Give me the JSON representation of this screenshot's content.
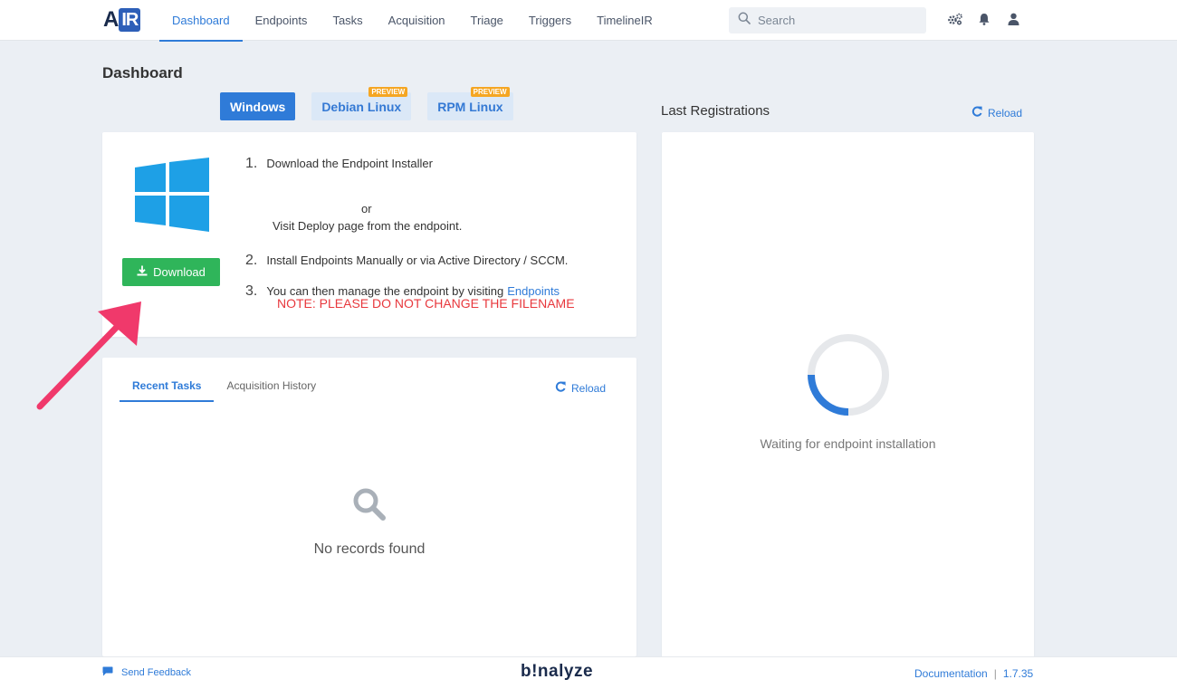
{
  "header": {
    "logo_a": "A",
    "logo_ir": "IR",
    "nav": [
      {
        "label": "Dashboard",
        "active": true
      },
      {
        "label": "Endpoints"
      },
      {
        "label": "Tasks"
      },
      {
        "label": "Acquisition"
      },
      {
        "label": "Triage"
      },
      {
        "label": "Triggers"
      },
      {
        "label": "TimelineIR"
      }
    ],
    "search_placeholder": "Search",
    "icons": [
      "settings-icon",
      "bell-icon",
      "user-icon"
    ]
  },
  "page": {
    "title": "Dashboard"
  },
  "os_tabs": [
    {
      "label": "Windows",
      "active": true,
      "badge": ""
    },
    {
      "label": "Debian Linux",
      "badge": "PREVIEW"
    },
    {
      "label": "RPM Linux",
      "badge": "PREVIEW"
    }
  ],
  "install": {
    "download_label": "Download",
    "step1_num": "1.",
    "step1_text": "Download the Endpoint Installer",
    "or_text": "or",
    "step1_sub": "Visit Deploy page from the endpoint.",
    "step2_num": "2.",
    "step2_text": "Install Endpoints Manually or via Active Directory / SCCM.",
    "step3_num": "3.",
    "step3_text": "You can then manage the endpoint by visiting",
    "step3_link": "Endpoints",
    "note": "NOTE: PLEASE DO NOT CHANGE THE FILENAME"
  },
  "tasks": {
    "tabs": [
      {
        "label": "Recent Tasks",
        "active": true
      },
      {
        "label": "Acquisition History"
      }
    ],
    "reload_label": "Reload",
    "empty_text": "No records found"
  },
  "registrations": {
    "title": "Last Registrations",
    "reload_label": "Reload",
    "waiting_text": "Waiting for endpoint installation"
  },
  "footer": {
    "feedback_label": "Send Feedback",
    "brand": "b!nalyze",
    "doc_label": "Documentation",
    "separator": "|",
    "version": "1.7.35"
  },
  "colors": {
    "accent": "#2f7bd8",
    "download": "#2fb55a",
    "note": "#e8383d",
    "badge": "#f5a623",
    "windows_logo": "#1ea0e6",
    "arrow": "#f0396b"
  }
}
